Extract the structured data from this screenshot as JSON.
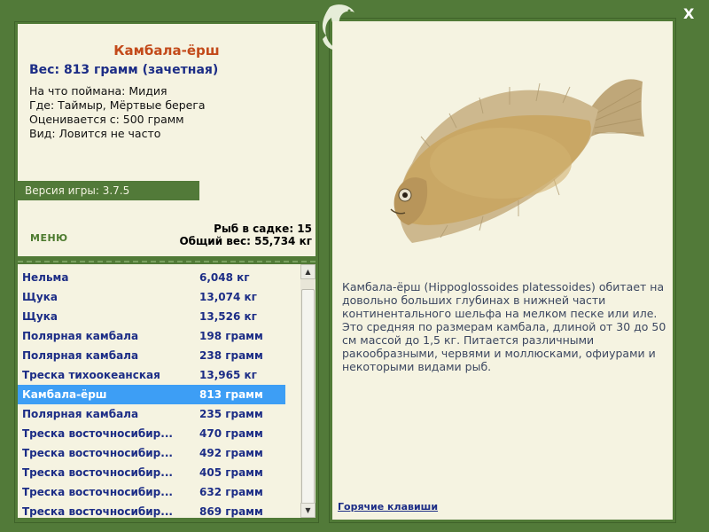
{
  "fish": {
    "title": "Камбала-ёрш",
    "weight_line": "Вес: 813 грамм (зачетная)",
    "caught_on": "На что поймана: Мидия",
    "location": "Где: Таймыр, Мёртвые берега",
    "valued_from": "Оценивается с: 500 грамм",
    "kind": "Вид: Ловится не часто"
  },
  "version": "Версия игры: 3.7.5",
  "menu_label": "МЕНЮ",
  "stats": {
    "count": "Рыб в садке: 15",
    "total": "Общий вес: 55,734 кг"
  },
  "catch_list": [
    {
      "name": "Нельма",
      "weight": "6,048 кг"
    },
    {
      "name": "Щука",
      "weight": "13,074 кг"
    },
    {
      "name": "Щука",
      "weight": "13,526 кг"
    },
    {
      "name": "Полярная камбала",
      "weight": "198 грамм"
    },
    {
      "name": "Полярная камбала",
      "weight": "238 грамм"
    },
    {
      "name": "Треска тихоокеанская",
      "weight": "13,965 кг"
    },
    {
      "name": "Камбала-ёрш",
      "weight": "813 грамм",
      "selected": true
    },
    {
      "name": "Полярная камбала",
      "weight": "235 грамм"
    },
    {
      "name": "Треска восточносибир...",
      "weight": "470 грамм"
    },
    {
      "name": "Треска восточносибир...",
      "weight": "492 грамм"
    },
    {
      "name": "Треска восточносибир...",
      "weight": "405 грамм"
    },
    {
      "name": "Треска восточносибир...",
      "weight": "632 грамм"
    },
    {
      "name": "Треска восточносибир...",
      "weight": "869 грамм"
    }
  ],
  "description": "Камбала-ёрш (Hippoglossoides platessoides) обитает на довольно больших глубинах в нижней части континентального шельфа на мелком песке или иле. Это средняя по размерам камбала, длиной от 30 до 50 см массой до 1,5 кг. Питается различными ракообразными, червями и моллюсками, офиурами и некоторыми видами рыб.",
  "hotkeys_label": "Горячие клавиши",
  "close_label": "X",
  "colors": {
    "frame": "#527a39",
    "panel": "#f5f3e1",
    "title": "#c34a1a",
    "text_blue": "#1c2d86",
    "selection": "#3d9ef5"
  },
  "icons": [
    "fish-logo-icon",
    "flounder-image",
    "close-icon",
    "scroll-up-icon",
    "scroll-down-icon"
  ]
}
